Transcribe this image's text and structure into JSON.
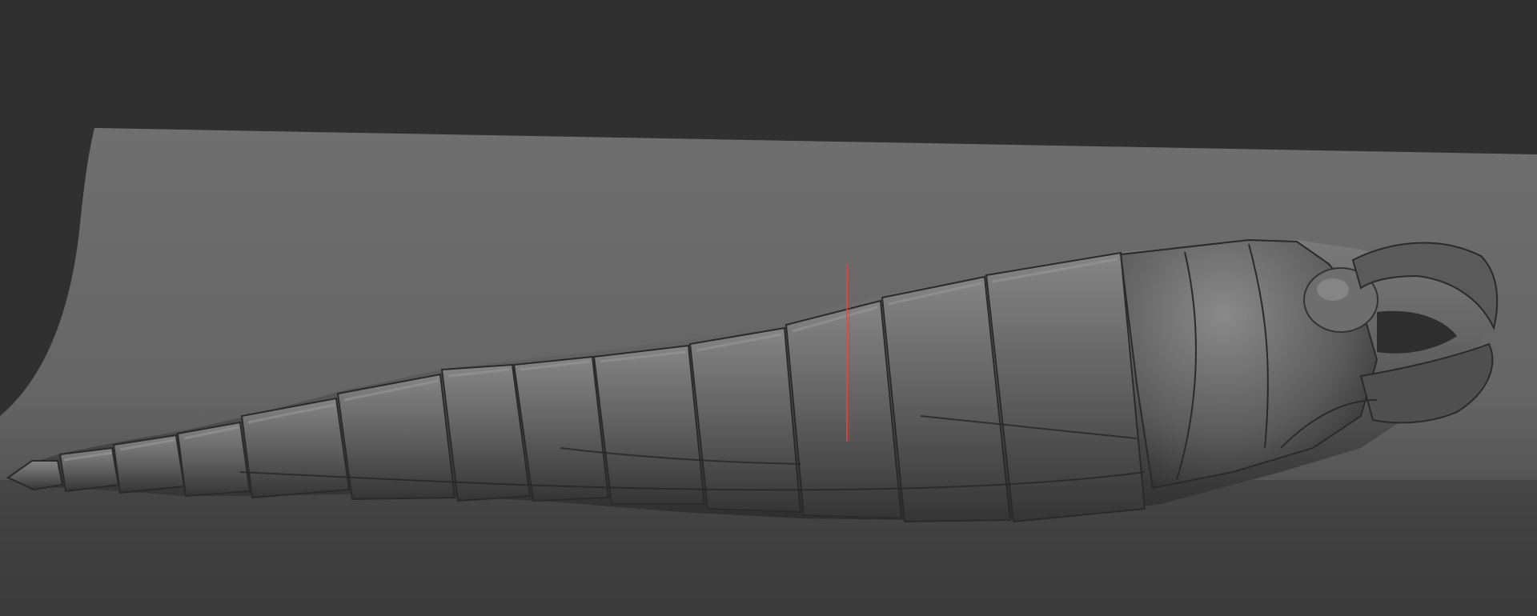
{
  "viewport": {
    "title": "",
    "background_color": "#303030",
    "floor_plane_color": "#6c6c6c",
    "model_color": "#5a5a5a",
    "cursor_color": "#e04848"
  },
  "scene": {
    "model_name_icon": "sculpt-mesh-icon",
    "cursor_icon": "brush-cursor-icon"
  }
}
